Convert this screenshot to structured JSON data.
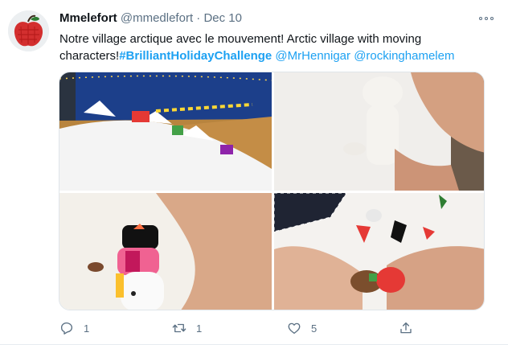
{
  "tweet": {
    "display_name": "Mmelefort",
    "handle": "@mmedlefort",
    "separator": "·",
    "date": "Dec 10",
    "text_part1": "Notre village arctique avec le mouvement! Arctic village with moving characters!",
    "hashtag": "#BrilliantHolidayChallenge",
    "mention1": "@MrHennigar",
    "mention2": "@rockinghamelem",
    "counts": {
      "replies": "1",
      "retweets": "1",
      "likes": "5"
    },
    "colors": {
      "link": "#1da1f2",
      "secondary_text": "#5b7083",
      "primary_text": "#0f1419"
    },
    "icons": [
      "more-icon",
      "reply-icon",
      "retweet-icon",
      "like-icon",
      "share-icon"
    ]
  }
}
